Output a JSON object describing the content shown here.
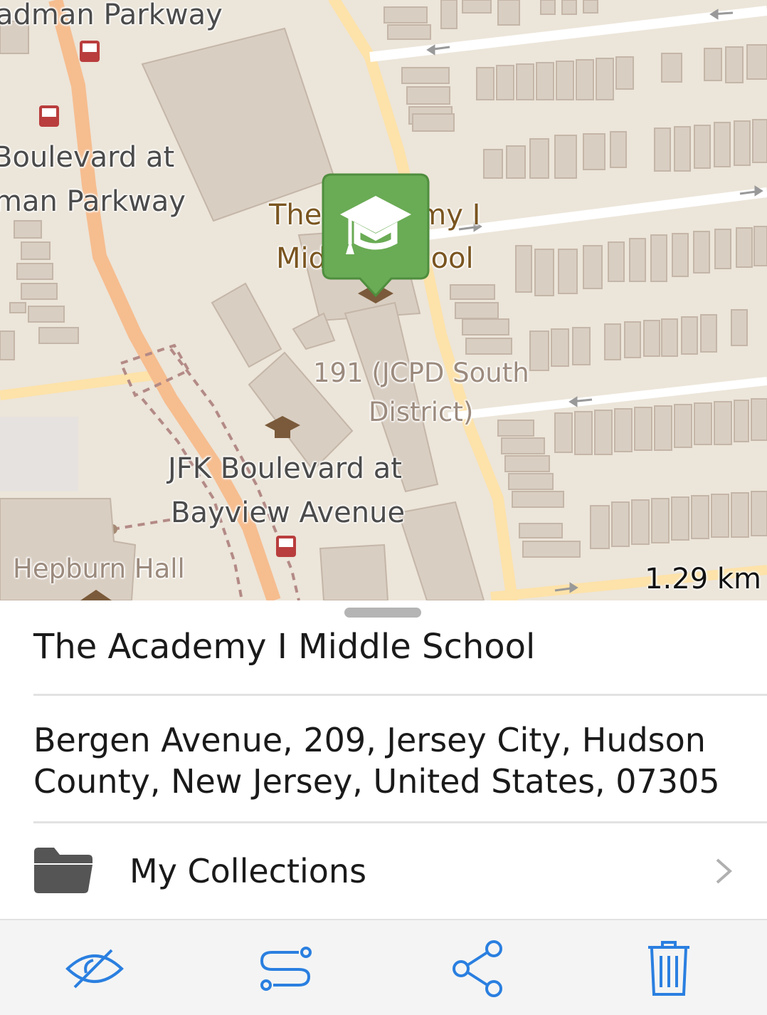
{
  "map": {
    "labels": {
      "street_top": "adman Parkway",
      "blvd_left_1": "Boulevard at",
      "blvd_left_2": "man Parkway",
      "school_1": "The Academy I",
      "school_2": "Middle School",
      "police_1": "191 (JCPD South",
      "police_2": "District)",
      "jfk_1": "JFK Boulevard at",
      "jfk_2": "Bayview Avenue",
      "hepburn": "Hepburn Hall"
    },
    "scale": "1.29 km",
    "marker_icon": "graduation-cap-icon",
    "colors": {
      "land": "#ece5d9",
      "building": "#d9cec2",
      "building_stroke": "#c4b6a8",
      "major_road": "#f6bd8f",
      "minor_road": "#fde2a9",
      "marker": "#6aab55"
    }
  },
  "place": {
    "title": "The Academy I Middle School",
    "address": "Bergen Avenue, 209, Jersey City, Hudson County, New Jersey, United States, 07305"
  },
  "collections": {
    "label": "My Collections",
    "icon": "folder-icon"
  },
  "toolbar": {
    "accent": "#2a7fe0",
    "buttons": [
      "hide-icon",
      "route-icon",
      "share-icon",
      "trash-icon"
    ]
  }
}
